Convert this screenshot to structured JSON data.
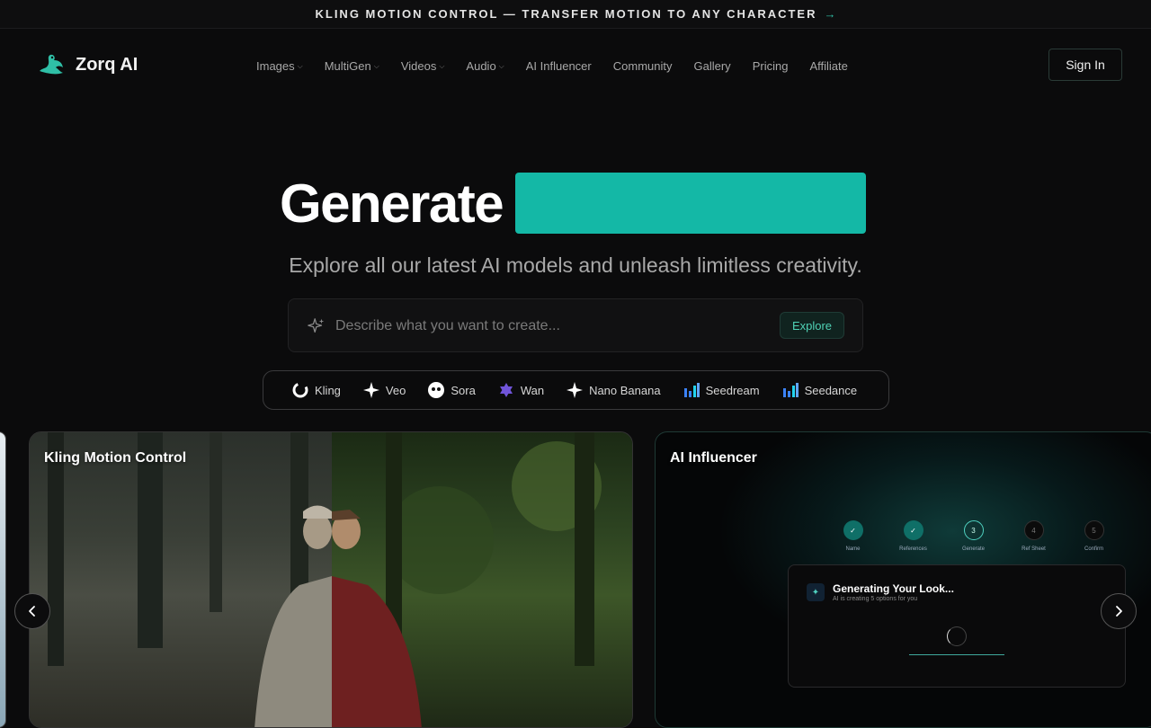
{
  "announcement": {
    "text": "KLING MOTION CONTROL — TRANSFER MOTION TO ANY CHARACTER",
    "arrow": "→"
  },
  "brand": {
    "name": "Zorq AI",
    "accent": "#14b8a6"
  },
  "nav": [
    {
      "label": "Images",
      "has_menu": true
    },
    {
      "label": "MultiGen",
      "has_menu": true
    },
    {
      "label": "Videos",
      "has_menu": true
    },
    {
      "label": "Audio",
      "has_menu": true
    },
    {
      "label": "AI Influencer",
      "has_menu": false
    },
    {
      "label": "Community",
      "has_menu": false
    },
    {
      "label": "Gallery",
      "has_menu": false
    },
    {
      "label": "Pricing",
      "has_menu": false
    },
    {
      "label": "Affiliate",
      "has_menu": false
    }
  ],
  "header": {
    "signin_label": "Sign In"
  },
  "hero": {
    "title": "Generate",
    "subtitle": "Explore all our latest AI models and unleash limitless creativity."
  },
  "search": {
    "placeholder": "Describe what you want to create...",
    "value": "",
    "button_label": "Explore"
  },
  "models": [
    {
      "label": "Kling",
      "icon": "kling-icon"
    },
    {
      "label": "Veo",
      "icon": "veo-icon"
    },
    {
      "label": "Sora",
      "icon": "sora-icon"
    },
    {
      "label": "Wan",
      "icon": "wan-icon"
    },
    {
      "label": "Nano Banana",
      "icon": "nano-banana-icon"
    },
    {
      "label": "Seedream",
      "icon": "seedream-icon"
    },
    {
      "label": "Seedance",
      "icon": "seedance-icon"
    }
  ],
  "cards": {
    "kling": {
      "title": "Kling Motion Control"
    },
    "influencer": {
      "title": "AI Influencer",
      "steps": [
        {
          "num": "✓",
          "label": "Name",
          "state": "done"
        },
        {
          "num": "✓",
          "label": "References",
          "state": "done"
        },
        {
          "num": "3",
          "label": "Generate",
          "state": "active"
        },
        {
          "num": "4",
          "label": "Ref Sheet",
          "state": "todo"
        },
        {
          "num": "5",
          "label": "Confirm",
          "state": "todo"
        }
      ],
      "panel_title": "Generating Your Look...",
      "panel_subtitle": "AI is creating 5 options for you"
    }
  },
  "carousel": {
    "prev": "‹",
    "next": "›"
  }
}
